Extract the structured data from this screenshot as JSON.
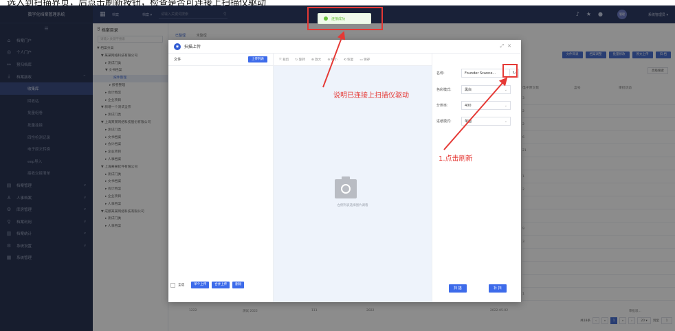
{
  "caption": "选入到扫描界页，后点击刷新按钮，检查是否可连接上扫描仪驱动",
  "app": {
    "title": "数字化档案管理系统",
    "topbar": {
      "crumb": "档案",
      "select": "档案 ▾",
      "search_placeholder": "请输入关键词搜索",
      "user": "系统管理员 ▾",
      "avatar_text": "管理"
    }
  },
  "sidebar": {
    "items": [
      {
        "icon": "⌂",
        "label": "档案门户"
      },
      {
        "icon": "◎",
        "label": "个人门户"
      },
      {
        "icon": "↔",
        "label": "预归档库"
      },
      {
        "icon": "⤓",
        "label": "档案接收",
        "arrow": "^"
      }
    ],
    "sub_items": [
      {
        "label": "收集库",
        "active": true
      },
      {
        "label": "回收站"
      },
      {
        "label": "批量组卷"
      },
      {
        "label": "批量挂接"
      },
      {
        "label": "四性检测记录"
      },
      {
        "label": "电子原文转换"
      },
      {
        "label": "eep导入"
      },
      {
        "label": "接收交接清单"
      }
    ],
    "groups": [
      {
        "icon": "▤",
        "label": "档案管理",
        "arrow": "v"
      },
      {
        "icon": "♙",
        "label": "人事档案",
        "arrow": "v"
      },
      {
        "icon": "⚙",
        "label": "库房管理",
        "arrow": "v"
      },
      {
        "icon": "⚲",
        "label": "档案利用",
        "arrow": "v"
      },
      {
        "icon": "▥",
        "label": "档案统计",
        "arrow": "v"
      },
      {
        "icon": "⚙",
        "label": "系统设置",
        "arrow": "v"
      },
      {
        "icon": "▦",
        "label": "系统管理",
        "arrow": ""
      }
    ]
  },
  "tree": {
    "title": "档案目录",
    "search_placeholder": "请输入关键字搜索",
    "nodes": [
      {
        "text": "▼ 档案分类",
        "indent": 6
      },
      {
        "text": "▼ 某某网络科技有限公司",
        "indent": 12
      },
      {
        "text": "▸ 测试门类",
        "indent": 18
      },
      {
        "text": "▼ 文书档案",
        "indent": 18
      },
      {
        "text": "按件整理",
        "indent": 30,
        "active": true
      },
      {
        "text": "▸ 按卷整理",
        "indent": 24
      },
      {
        "text": "▸ 会计档案",
        "indent": 18
      },
      {
        "text": "▸ 企业项目",
        "indent": 18
      },
      {
        "text": "▼ 新增一个测试全宗",
        "indent": 12
      },
      {
        "text": "▸ 测试门类",
        "indent": 18
      },
      {
        "text": "▼ 上海某某网络科技股份有限公司",
        "indent": 12
      },
      {
        "text": "▸ 测试门类",
        "indent": 18
      },
      {
        "text": "▸ 文书档案",
        "indent": 18
      },
      {
        "text": "▸ 会计档案",
        "indent": 18
      },
      {
        "text": "▸ 企业项目",
        "indent": 18
      },
      {
        "text": "▸ 人事档案",
        "indent": 18
      },
      {
        "text": "▼ 上海某某软件有限公司",
        "indent": 12
      },
      {
        "text": "▸ 测试门类",
        "indent": 18
      },
      {
        "text": "▸ 文书档案",
        "indent": 18
      },
      {
        "text": "▸ 会计档案",
        "indent": 18
      },
      {
        "text": "▸ 企业项目",
        "indent": 18
      },
      {
        "text": "▸ 人事档案",
        "indent": 18
      },
      {
        "text": "▼ 成都某某网络科技有限公司",
        "indent": 12
      },
      {
        "text": "▸ 测试门类",
        "indent": 18
      },
      {
        "text": "▸ 人事档案",
        "indent": 18
      }
    ]
  },
  "main": {
    "tab_active": "已整理",
    "tab_other": "未整理",
    "buttons": [
      "文件目录",
      "档案调整",
      "批量修改",
      "原文上传",
      "归 档"
    ],
    "advanced_search": "高级搜索",
    "columns": [
      "电子原文数",
      "盒号",
      "审批状态"
    ],
    "row_values": [
      "3",
      "2",
      "2",
      "6",
      "21",
      "",
      "1",
      "2",
      "",
      "",
      "9",
      "3",
      "",
      "",
      "",
      "1"
    ],
    "last_row": [
      "1222",
      "测试 2022",
      "111",
      "2022",
      "2022-05-02"
    ],
    "last_row_status": "审批驳...",
    "pager": {
      "total": "共18条",
      "page": "1",
      "size": "20 ▾",
      "goto": "到至",
      "goto_val": "1"
    }
  },
  "toast": {
    "text": "连接成功"
  },
  "modal": {
    "title": "扫描上传",
    "left": {
      "file_label": "文件",
      "upload_list": "上传列表",
      "select_all": "全选",
      "single_upload": "单个上传",
      "merge_upload": "合并上传",
      "delete": "删除"
    },
    "tools": [
      "⤧ 裁剪",
      "↻ 旋转",
      "⊕ 放大",
      "⊖ 缩小",
      "⟲ 恢复",
      "▭ 保存"
    ],
    "canvas_tip": "左侧列表选择图片调看",
    "right": {
      "name_label": "名称:",
      "name_value": "Founder Scanne...",
      "color_label": "色彩模式:",
      "color_value": "黑白",
      "dpi_label": "分辨率:",
      "dpi_value": "400",
      "paper_label": "进纸模式:",
      "paper_value": "单面",
      "scan_btn": "扫 描",
      "rescan_btn": "补 扫"
    }
  },
  "annotations": {
    "driver_connected": "说明已连接上扫描仪驱动",
    "click_refresh": "1.点击刷新"
  }
}
